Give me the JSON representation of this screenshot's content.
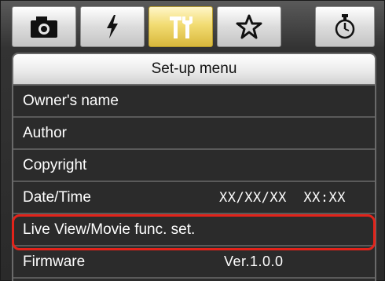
{
  "tabs": [
    {
      "icon": "camera-icon",
      "active": false
    },
    {
      "icon": "flash-icon",
      "active": false
    },
    {
      "icon": "wrench-tools-icon",
      "active": true
    },
    {
      "icon": "star-icon",
      "active": false
    },
    {
      "icon": "stopwatch-icon",
      "active": false
    }
  ],
  "panel": {
    "title": "Set-up menu"
  },
  "menu": {
    "owner": "Owner's name",
    "author": "Author",
    "copyright": "Copyright",
    "datetime": "Date/Time",
    "datetime_value": "XX/XX/XX  XX:XX",
    "liveview": "Live View/Movie func. set.",
    "firmware": "Firmware",
    "firmware_value": "Ver.1.0.0"
  },
  "colors": {
    "highlight": "#e3231a",
    "active_tab": "#f2dc73"
  }
}
